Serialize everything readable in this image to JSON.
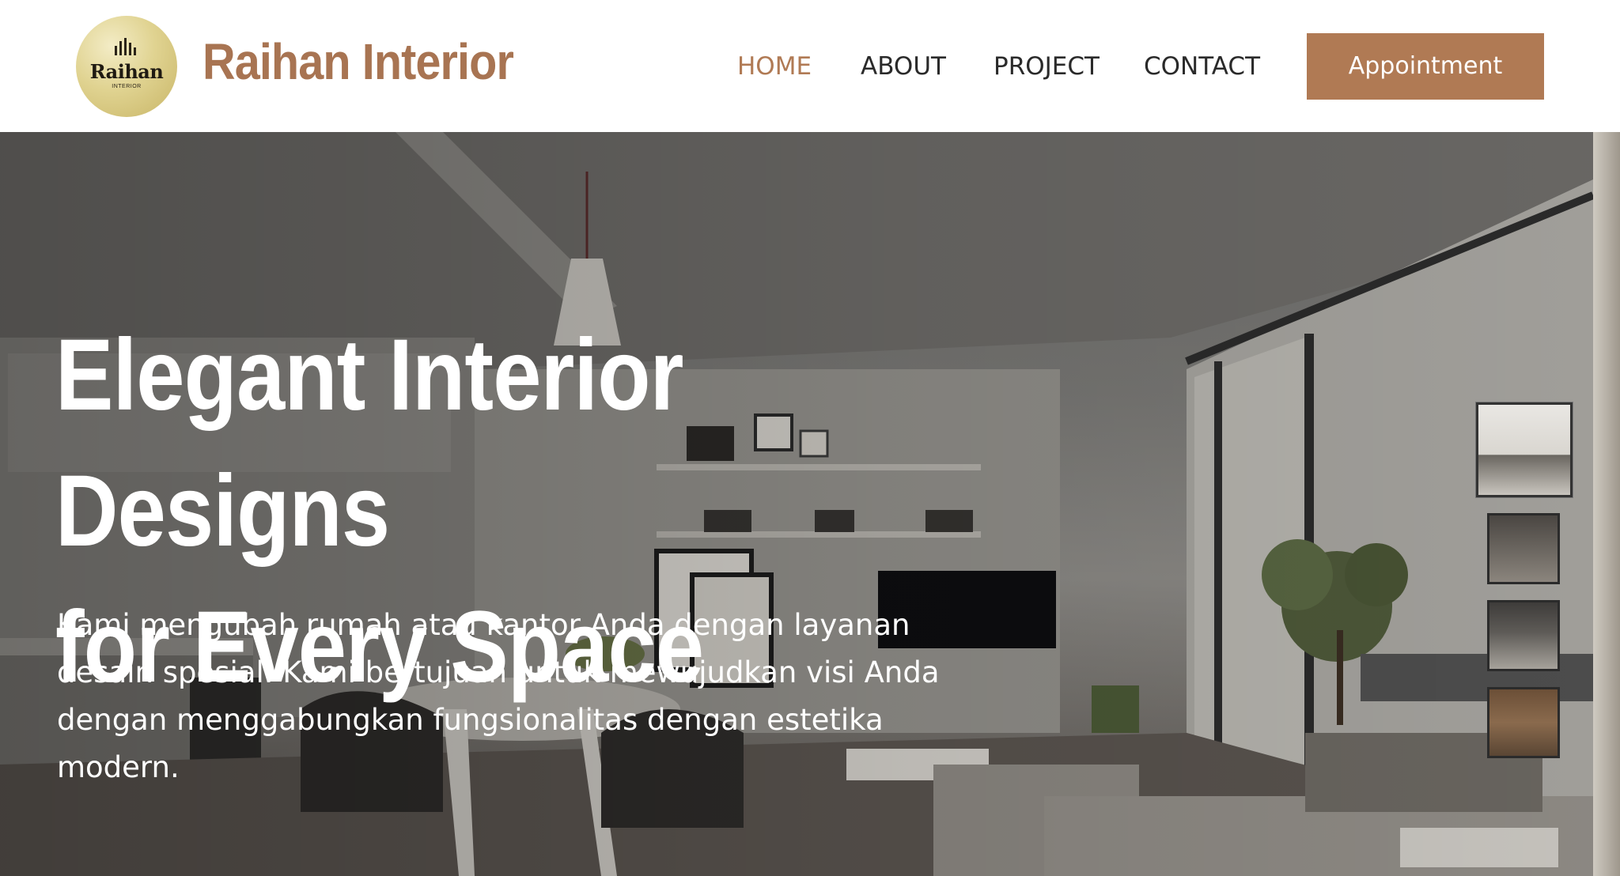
{
  "logo": {
    "name": "Raihan",
    "sub": "INTERIOR",
    "accent": "#d8c97e"
  },
  "brand": {
    "title": "Raihan Interior",
    "color": "#a87452"
  },
  "nav": {
    "items": [
      {
        "label": "HOME",
        "active": true
      },
      {
        "label": "ABOUT",
        "active": false
      },
      {
        "label": "PROJECT",
        "active": false
      },
      {
        "label": "CONTACT",
        "active": false
      }
    ],
    "active_color": "#b07a54"
  },
  "cta": {
    "label": "Appointment",
    "color": "#b07a54"
  },
  "hero": {
    "title_line1": "Elegant Interior Designs",
    "title_line2": "for Every Space",
    "description": "Kami mengubah rumah atau kantor Anda dengan layanan desain spesial. Kami bertujuan untuk mewujudkan visi Anda dengan menggabungkan fungsionalitas dengan estetika modern."
  },
  "thumbnails": [
    {
      "name": "bright-living-room",
      "active": true
    },
    {
      "name": "dark-lounge",
      "active": false
    },
    {
      "name": "grey-living-room",
      "active": false
    },
    {
      "name": "warm-bedroom",
      "active": false
    }
  ]
}
